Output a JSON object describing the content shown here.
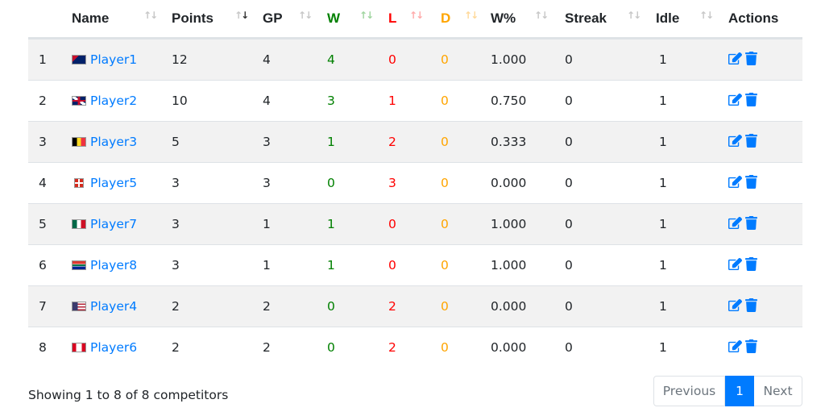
{
  "table": {
    "headers": [
      {
        "label": "",
        "sortable": false
      },
      {
        "label": "Name",
        "sortable": true
      },
      {
        "label": "Points",
        "sortable": true
      },
      {
        "label": "GP",
        "sortable": true
      },
      {
        "label": "W",
        "sortable": true,
        "color": "#008000"
      },
      {
        "label": "L",
        "sortable": true,
        "color": "#ff0000"
      },
      {
        "label": "D",
        "sortable": true,
        "color": "#ffa500"
      },
      {
        "label": "W%",
        "sortable": true
      },
      {
        "label": "Streak",
        "sortable": true
      },
      {
        "label": "Idle",
        "sortable": true
      },
      {
        "label": "Actions",
        "sortable": false
      }
    ],
    "sorted_column": "Points",
    "rows": [
      {
        "rank": "1",
        "flag": "australia-flag",
        "name": "Player1",
        "points": "12",
        "gp": "4",
        "w": "4",
        "l": "0",
        "d": "0",
        "wpct": "1.000",
        "streak": "0",
        "idle": "1"
      },
      {
        "rank": "2",
        "flag": "uk-flag",
        "name": "Player2",
        "points": "10",
        "gp": "4",
        "w": "3",
        "l": "1",
        "d": "0",
        "wpct": "0.750",
        "streak": "0",
        "idle": "1"
      },
      {
        "rank": "3",
        "flag": "belgium-flag",
        "name": "Player3",
        "points": "5",
        "gp": "3",
        "w": "1",
        "l": "2",
        "d": "0",
        "wpct": "0.333",
        "streak": "0",
        "idle": "1"
      },
      {
        "rank": "4",
        "flag": "switzerland-flag",
        "name": "Player5",
        "points": "3",
        "gp": "3",
        "w": "0",
        "l": "3",
        "d": "0",
        "wpct": "0.000",
        "streak": "0",
        "idle": "1"
      },
      {
        "rank": "5",
        "flag": "mexico-flag",
        "name": "Player7",
        "points": "3",
        "gp": "1",
        "w": "1",
        "l": "0",
        "d": "0",
        "wpct": "1.000",
        "streak": "0",
        "idle": "1"
      },
      {
        "rank": "6",
        "flag": "south-africa-flag",
        "name": "Player8",
        "points": "3",
        "gp": "1",
        "w": "1",
        "l": "0",
        "d": "0",
        "wpct": "1.000",
        "streak": "0",
        "idle": "1"
      },
      {
        "rank": "7",
        "flag": "usa-flag",
        "name": "Player4",
        "points": "2",
        "gp": "2",
        "w": "0",
        "l": "2",
        "d": "0",
        "wpct": "0.000",
        "streak": "0",
        "idle": "1"
      },
      {
        "rank": "8",
        "flag": "canada-flag",
        "name": "Player6",
        "points": "2",
        "gp": "2",
        "w": "0",
        "l": "2",
        "d": "0",
        "wpct": "0.000",
        "streak": "0",
        "idle": "1"
      }
    ]
  },
  "footer": {
    "info": "Showing 1 to 8 of 8 competitors"
  },
  "pagination": {
    "previous": "Previous",
    "current": "1",
    "next": "Next"
  },
  "colors": {
    "win": "#008000",
    "loss": "#ff0000",
    "draw": "#ffa500",
    "accent": "#007bff",
    "stripe": "#f2f2f2"
  },
  "icons": {
    "edit": "edit-icon",
    "delete": "trash-icon"
  }
}
